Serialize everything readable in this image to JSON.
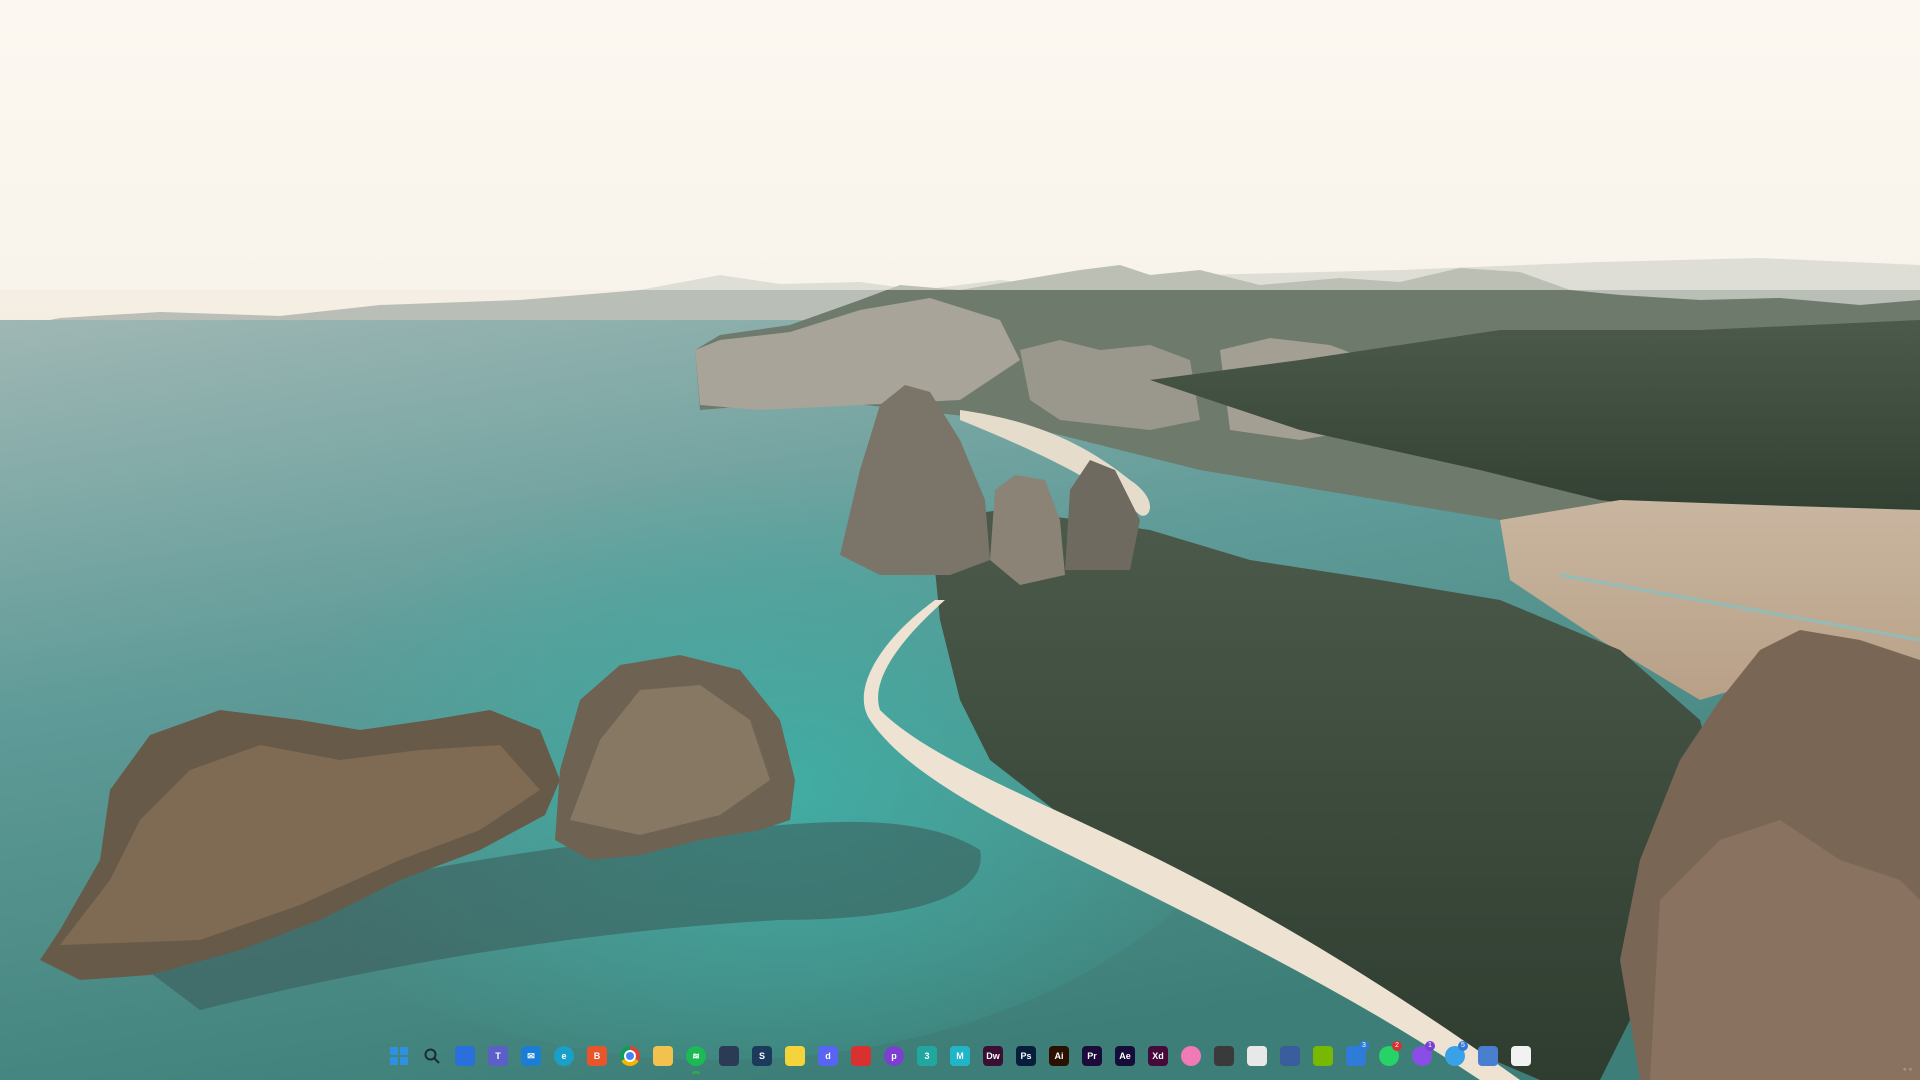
{
  "desktop": {
    "wallpaper": "aerial-coastline-limestone-karsts"
  },
  "taskbar": {
    "apps": [
      {
        "name": "start",
        "icon": "windows-logo-icon",
        "glyph": "",
        "color": "#2f8fe0",
        "active": false
      },
      {
        "name": "search",
        "icon": "search-icon",
        "glyph": "",
        "color": "transparent",
        "active": false
      },
      {
        "name": "task-view",
        "icon": "task-view-icon",
        "glyph": "",
        "color": "#2a6fdc",
        "active": false
      },
      {
        "name": "teams",
        "icon": "teams-icon",
        "glyph": "T",
        "color": "#5b5fc7",
        "active": false
      },
      {
        "name": "mail",
        "icon": "mail-icon",
        "glyph": "✉",
        "color": "#1a7fd4",
        "active": false
      },
      {
        "name": "edge",
        "icon": "edge-icon",
        "glyph": "e",
        "color": "#19a0c8",
        "active": false
      },
      {
        "name": "brave",
        "icon": "brave-icon",
        "glyph": "B",
        "color": "#e8552a",
        "active": false
      },
      {
        "name": "chrome",
        "icon": "chrome-icon",
        "glyph": "",
        "color": "#e9c33a",
        "active": false
      },
      {
        "name": "file-explorer",
        "icon": "folder-icon",
        "glyph": "",
        "color": "#f2c14e",
        "active": false
      },
      {
        "name": "spotify",
        "icon": "spotify-icon",
        "glyph": "≋",
        "color": "#1db954",
        "active": true
      },
      {
        "name": "store",
        "icon": "store-icon",
        "glyph": "",
        "color": "#2b3b55",
        "active": false
      },
      {
        "name": "steam",
        "icon": "steam-icon",
        "glyph": "S",
        "color": "#1b3a5c",
        "active": false
      },
      {
        "name": "sticky-notes",
        "icon": "sticky-notes-icon",
        "glyph": "",
        "color": "#f5d33b",
        "active": false
      },
      {
        "name": "discord",
        "icon": "discord-icon",
        "glyph": "d",
        "color": "#5865f2",
        "active": false
      },
      {
        "name": "app-red",
        "icon": "red-app-icon",
        "glyph": "",
        "color": "#d8312f",
        "active": false
      },
      {
        "name": "app-purple",
        "icon": "purple-app-icon",
        "glyph": "p",
        "color": "#7d3fd0",
        "active": false
      },
      {
        "name": "app-teal",
        "icon": "teal-app-icon",
        "glyph": "3",
        "color": "#1fa7a0",
        "active": false
      },
      {
        "name": "app-cyan",
        "icon": "cyan-app-icon",
        "glyph": "M",
        "color": "#20b6c8",
        "active": false
      },
      {
        "name": "dreamweaver",
        "icon": "dreamweaver-icon",
        "glyph": "Dw",
        "color": "#3b0e33",
        "active": false
      },
      {
        "name": "photoshop",
        "icon": "photoshop-icon",
        "glyph": "Ps",
        "color": "#061e3c",
        "active": false
      },
      {
        "name": "illustrator",
        "icon": "illustrator-icon",
        "glyph": "Ai",
        "color": "#2b1000",
        "active": false
      },
      {
        "name": "premiere",
        "icon": "premiere-icon",
        "glyph": "Pr",
        "color": "#1d0b3a",
        "active": false
      },
      {
        "name": "after-effects",
        "icon": "after-effects-icon",
        "glyph": "Ae",
        "color": "#160c3a",
        "active": false
      },
      {
        "name": "xd",
        "icon": "xd-icon",
        "glyph": "Xd",
        "color": "#460a3a",
        "active": false
      },
      {
        "name": "photos",
        "icon": "photos-icon",
        "glyph": "",
        "color": "#f07ab5",
        "active": false
      },
      {
        "name": "davinci",
        "icon": "davinci-icon",
        "glyph": "",
        "color": "#3a3a3a",
        "active": false
      },
      {
        "name": "app-white",
        "icon": "document-app-icon",
        "glyph": "",
        "color": "#e8e8e8",
        "active": false
      },
      {
        "name": "app-blue-doc",
        "icon": "notes-app-icon",
        "glyph": "",
        "color": "#3a5d9e",
        "active": false
      },
      {
        "name": "nvidia",
        "icon": "nvidia-icon",
        "glyph": "",
        "color": "#76b900",
        "active": false
      },
      {
        "name": "app-blue-badge",
        "icon": "blue-app-icon",
        "glyph": "",
        "color": "#2f7bd8",
        "active": false,
        "badge": "3",
        "badge_color": "#2f7bd8"
      },
      {
        "name": "whatsapp",
        "icon": "whatsapp-icon",
        "glyph": "",
        "color": "#25d366",
        "active": false,
        "badge": "2",
        "badge_color": "#d83030"
      },
      {
        "name": "messenger",
        "icon": "messenger-icon",
        "glyph": "",
        "color": "#8a4ee6",
        "active": false,
        "badge": "1",
        "badge_color": "#7a3fd6"
      },
      {
        "name": "app-light-blue",
        "icon": "light-blue-app-icon",
        "glyph": "",
        "color": "#3aa0e8",
        "active": false,
        "badge": "5",
        "badge_color": "#2f7bd8"
      },
      {
        "name": "calculator",
        "icon": "calculator-icon",
        "glyph": "",
        "color": "#4a7fd0",
        "active": false
      },
      {
        "name": "app-white-2",
        "icon": "white-app-icon",
        "glyph": "",
        "color": "#f2f2f2",
        "active": false
      }
    ]
  }
}
